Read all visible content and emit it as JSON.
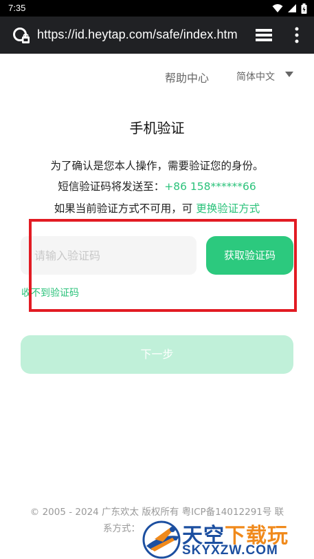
{
  "status_bar": {
    "time": "7:35"
  },
  "browser": {
    "url": "https://id.heytap.com/safe/index.htm"
  },
  "header": {
    "help": "帮助中心",
    "language": "简体中文"
  },
  "title": "手机验证",
  "description": {
    "line1": "为了确认是您本人操作，需要验证您的身份。",
    "line2_prefix": "短信验证码将发送至：",
    "phone": "+86 158******66",
    "line3_prefix": "如果当前验证方式不可用，可",
    "change_method": "更换验证方式"
  },
  "form": {
    "code_placeholder": "请输入验证码",
    "get_code": "获取验证码",
    "no_code": "收不到验证码",
    "next": "下一步"
  },
  "footer": {
    "line1": "© 2005 - 2024 广东欢太 版权所有 粤ICP备14012291号 联",
    "line2": "系方式："
  },
  "watermark": {
    "title": "天空下载玩",
    "title_plain": "天空",
    "title_accent": "下载玩",
    "subtitle": "SKYXZW.COM"
  },
  "colors": {
    "accent": "#2ac27a",
    "button": "#2cc97e",
    "button_disabled": "#c0f0d9",
    "highlight": "#e21b23",
    "watermark": "#1c4fa0"
  }
}
